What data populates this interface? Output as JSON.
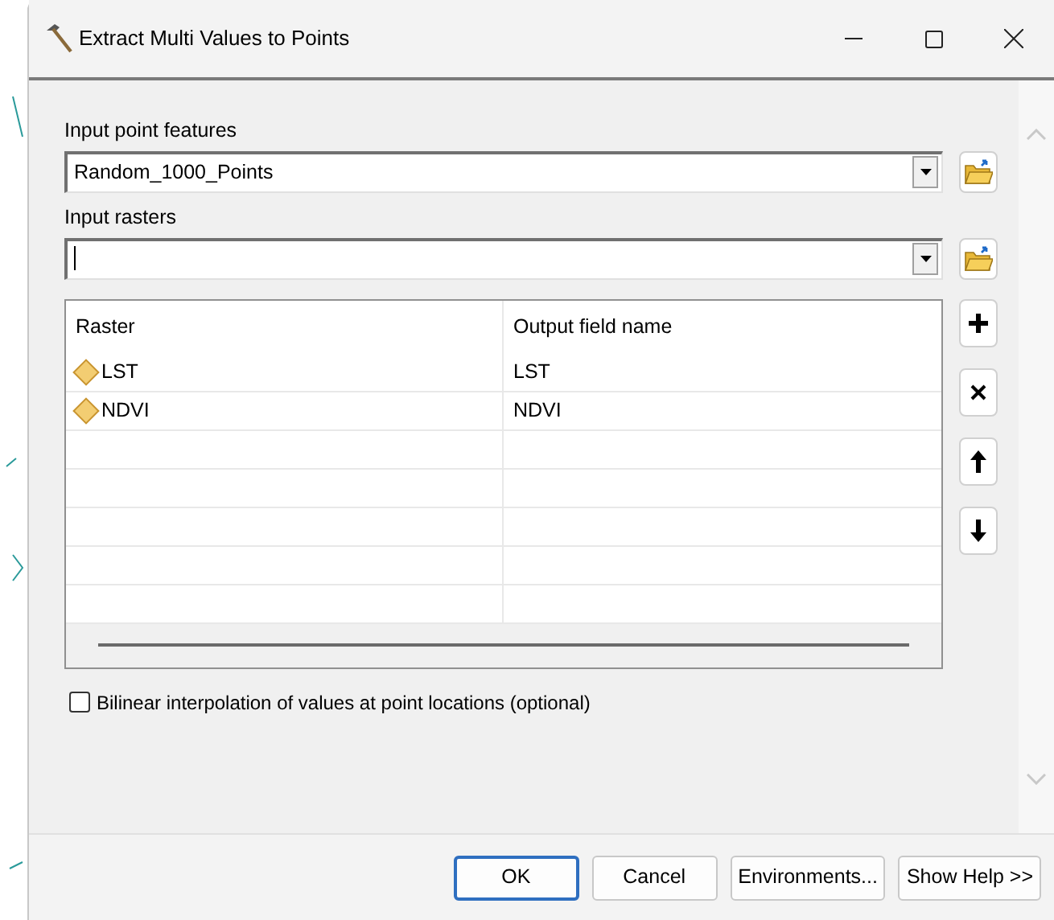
{
  "window": {
    "title": "Extract Multi Values to Points"
  },
  "input_point_features": {
    "label": "Input point features",
    "value": "Random_1000_Points"
  },
  "input_rasters": {
    "label": "Input rasters"
  },
  "table": {
    "columns": [
      "Raster",
      "Output field name"
    ],
    "rows": [
      {
        "raster": "LST",
        "output_field_name": "LST"
      },
      {
        "raster": "NDVI",
        "output_field_name": "NDVI"
      }
    ]
  },
  "bilinear_checkbox": {
    "label": "Bilinear interpolation of values at point locations (optional)",
    "checked": false
  },
  "buttons": [
    {
      "label": "OK",
      "default": true
    },
    {
      "label": "Cancel",
      "default": false
    },
    {
      "label": "Environments...",
      "default": false
    },
    {
      "label": "Show Help >>",
      "default": false
    }
  ]
}
